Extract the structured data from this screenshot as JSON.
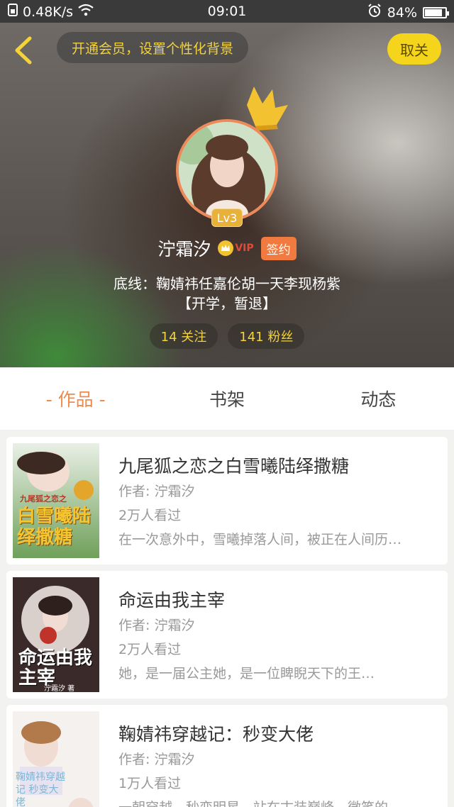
{
  "status_bar": {
    "speed": "0.48K/s",
    "time": "09:01",
    "battery": "84%",
    "battery_level": 0.84
  },
  "header": {
    "member_prompt": "开通会员，设置个性化背景",
    "unfollow_label": "取关",
    "level": "Lv3",
    "username": "泞霜汐",
    "vip_label": "VIP",
    "signed_label": "签约",
    "bio_line1": "底线：鞠婧祎任嘉伦胡一天李现杨紫",
    "bio_line2": "【开学，暂退】",
    "following": "14 关注",
    "followers": "141 粉丝"
  },
  "tabs": [
    {
      "label": "- 作品 -",
      "active": true
    },
    {
      "label": "书架",
      "active": false
    },
    {
      "label": "动态",
      "active": false
    }
  ],
  "books": [
    {
      "title": "九尾狐之恋之白雪曦陆绎撒糖",
      "author": "作者: 泞霜汐",
      "views": "2万人看过",
      "desc": "在一次意外中，雪曦掉落人间，被正在人间历…",
      "cover_text": "白雪曦陆绎撒糖",
      "cover_subtitle": "九尾狐之恋之"
    },
    {
      "title": "命运由我主宰",
      "author": "作者: 泞霜汐",
      "views": "2万人看过",
      "desc": "她，是一届公主她，是一位睥睨天下的王…",
      "cover_text": "命运由我主宰",
      "cover_subtitle": "泞霜汐 著"
    },
    {
      "title": "鞠婧祎穿越记：秒变大佬",
      "author": "作者: 泞霜汐",
      "views": "1万人看过",
      "desc": "一朝穿越，秒变明星，站在古装巅峰，微笑的…",
      "cover_text": "鞠婧祎穿越记 秒变大佬",
      "cover_subtitle": ""
    }
  ],
  "colors": {
    "accent": "#f08a4b",
    "gold": "#f3d23a",
    "unfollow_bg": "#f5d51b"
  }
}
